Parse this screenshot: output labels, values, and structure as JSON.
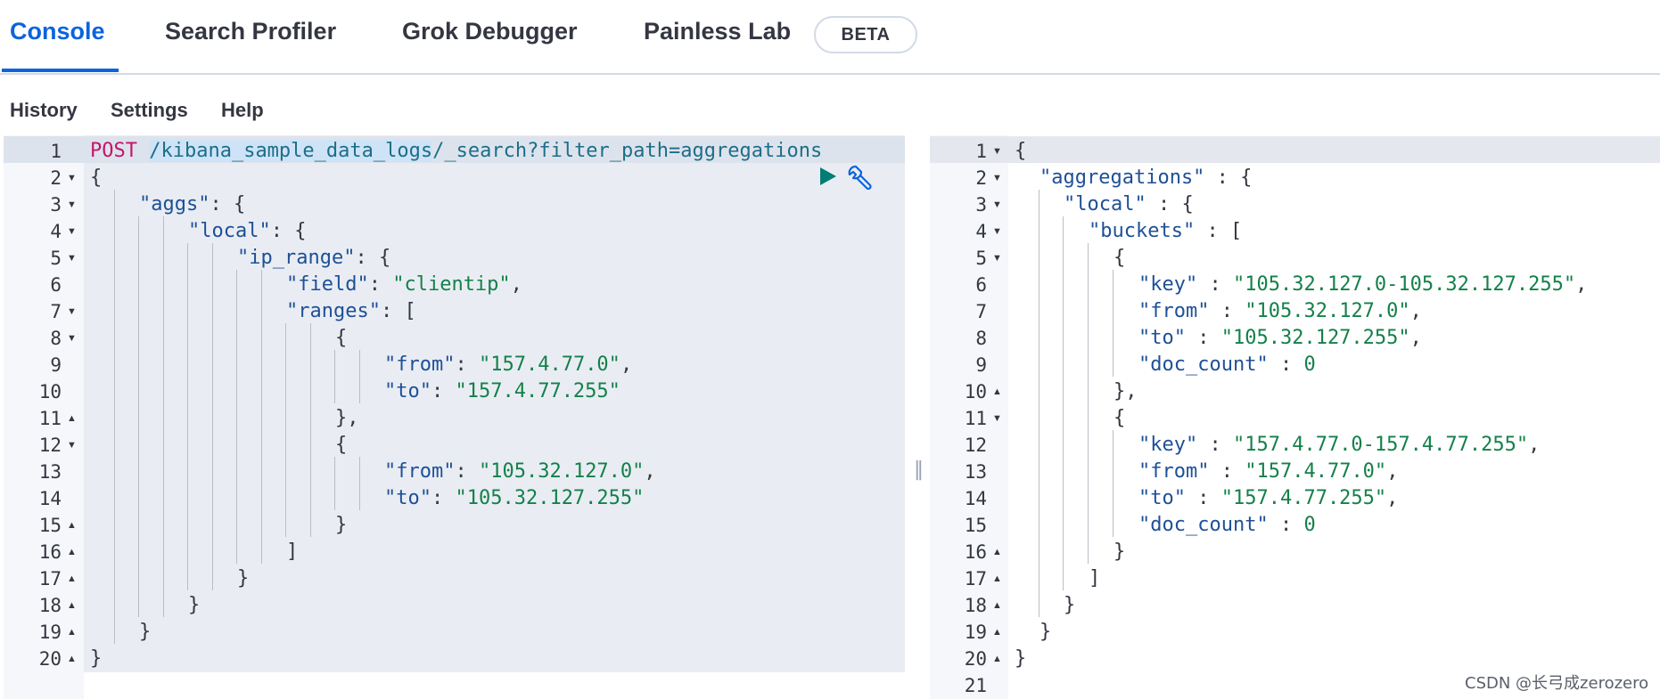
{
  "tabs": {
    "console": "Console",
    "search_profiler": "Search Profiler",
    "grok_debugger": "Grok Debugger",
    "painless_lab": "Painless Lab",
    "beta_badge": "BETA"
  },
  "menu": {
    "history": "History",
    "settings": "Settings",
    "help": "Help"
  },
  "request": {
    "method": "POST",
    "index_path": "/kibana_sample_data_logs",
    "endpoint": "/_search?filter_path=aggregations",
    "line_numbers": [
      "1",
      "2",
      "3",
      "4",
      "5",
      "6",
      "7",
      "8",
      "9",
      "10",
      "11",
      "12",
      "13",
      "14",
      "15",
      "16",
      "17",
      "18",
      "19",
      "20"
    ],
    "body": {
      "aggs_key": "\"aggs\"",
      "local_key": "\"local\"",
      "ip_range_key": "\"ip_range\"",
      "field_key": "\"field\"",
      "field_value": "\"clientip\"",
      "ranges_key": "\"ranges\"",
      "from_key": "\"from\"",
      "to_key": "\"to\"",
      "range1_from": "\"157.4.77.0\"",
      "range1_to": "\"157.4.77.255\"",
      "range2_from": "\"105.32.127.0\"",
      "range2_to": "\"105.32.127.255\""
    }
  },
  "response": {
    "line_numbers": [
      "1",
      "2",
      "3",
      "4",
      "5",
      "6",
      "7",
      "8",
      "9",
      "10",
      "11",
      "12",
      "13",
      "14",
      "15",
      "16",
      "17",
      "18",
      "19",
      "20",
      "21"
    ],
    "aggregations_key": "\"aggregations\"",
    "local_key": "\"local\"",
    "buckets_key": "\"buckets\"",
    "key_key": "\"key\"",
    "from_key": "\"from\"",
    "to_key": "\"to\"",
    "doc_count_key": "\"doc_count\"",
    "bucket1_key": "\"105.32.127.0-105.32.127.255\"",
    "bucket1_from": "\"105.32.127.0\"",
    "bucket1_to": "\"105.32.127.255\"",
    "bucket1_doc_count": "0",
    "bucket2_key": "\"157.4.77.0-157.4.77.255\"",
    "bucket2_from": "\"157.4.77.0\"",
    "bucket2_to": "\"157.4.77.255\"",
    "bucket2_doc_count": "0"
  },
  "icons": {
    "run": "play-icon",
    "settings": "wrench-icon",
    "resize": "resize-handle-icon"
  },
  "colors": {
    "accent": "#0b64dd",
    "string": "#14804a",
    "method": "#c4166c",
    "key": "#1e5096"
  },
  "watermark": "CSDN @长弓成zerozero"
}
